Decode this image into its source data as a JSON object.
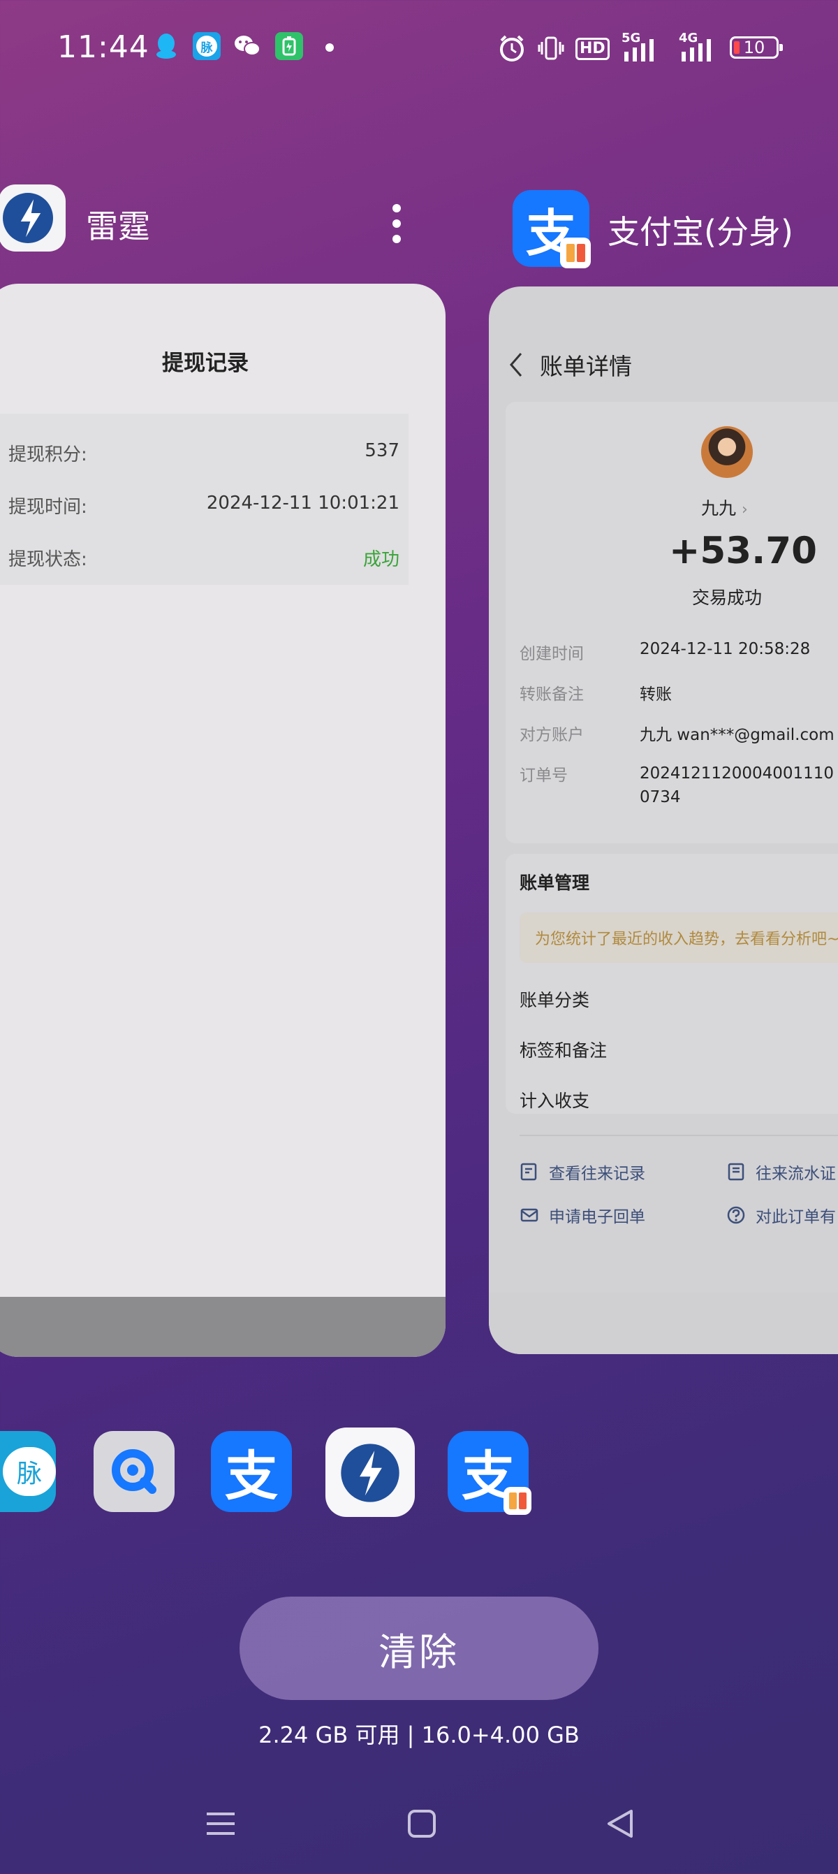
{
  "status_bar": {
    "time": "11:44",
    "mai_badge": "脉",
    "hd_label": "HD",
    "net_5g": "5G",
    "net_4g": "4G",
    "battery_level": "10"
  },
  "left_app": {
    "name": "雷霆",
    "page_title": "提现记录",
    "rows": [
      {
        "label": "提现积分:",
        "value": "537"
      },
      {
        "label": "提现时间:",
        "value": "2024-12-11 10:01:21"
      },
      {
        "label": "提现状态:",
        "value": "成功"
      }
    ],
    "status_color": "#3aa43a"
  },
  "right_app": {
    "name": "支付宝(分身)",
    "icon_glyph": "支",
    "page_title": "账单详情",
    "payer_name": "九九",
    "amount": "+53.70",
    "trade_status": "交易成功",
    "details": [
      {
        "label": "创建时间",
        "value": "2024-12-11 20:58:28"
      },
      {
        "label": "转账备注",
        "value": "转账"
      },
      {
        "label": "对方账户",
        "value": "九九 wan***@gmail.com"
      },
      {
        "label": "订单号",
        "value": "20241211200040011100734"
      }
    ],
    "section_title": "账单管理",
    "tip": "为您统计了最近的收入趋势，去看看分析吧~",
    "menu": [
      "账单分类",
      "标签和备注",
      "计入收支"
    ],
    "actions": [
      "查看往来记录",
      "往来流水证",
      "申请电子回单",
      "对此订单有"
    ]
  },
  "dock": {
    "mai_label": "脉",
    "alipay_glyph": "支"
  },
  "clear_button": "清除",
  "memory": "2.24 GB 可用 | 16.0+4.00 GB",
  "colors": {
    "accent_blue": "#1677ff",
    "ok_green": "#3aa43a",
    "tip_text": "#b08a3e"
  }
}
